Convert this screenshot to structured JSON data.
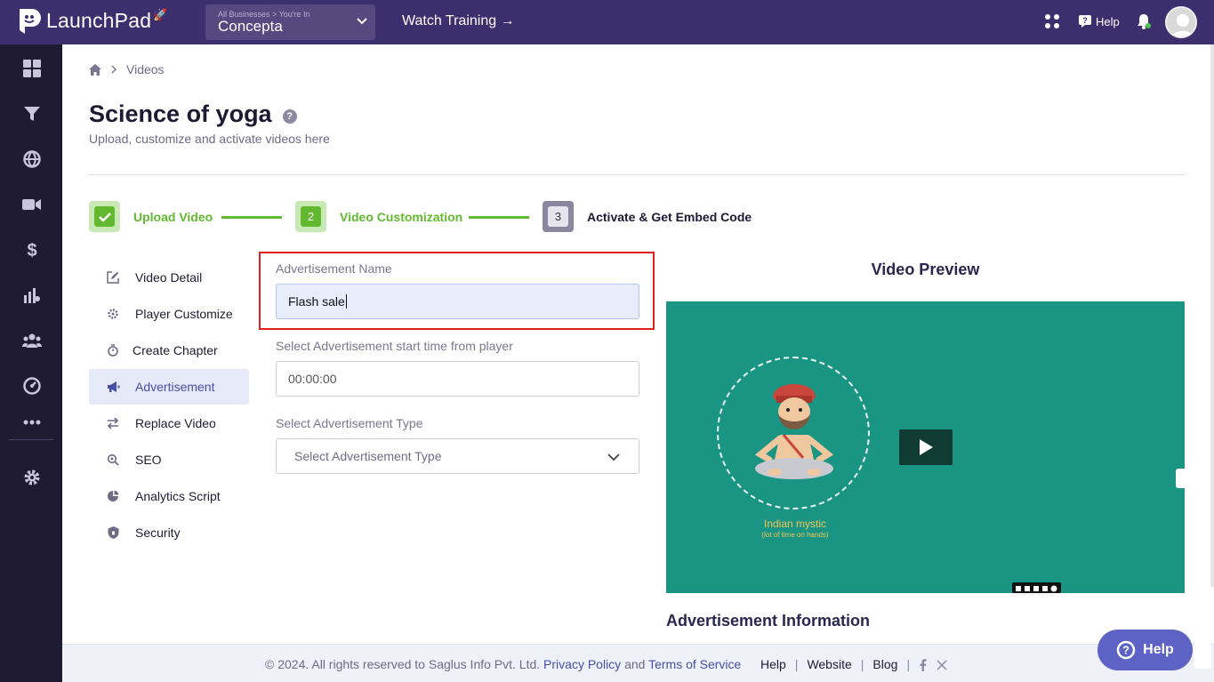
{
  "topbar": {
    "logo_text": "LaunchPad",
    "business_small": "All Businesses  >  You're In",
    "business_name": "Concepta",
    "watch_training": "Watch Training →",
    "help": "Help"
  },
  "breadcrumb": {
    "current": "Videos"
  },
  "page": {
    "title": "Science of yoga",
    "subtitle": "Upload, customize and activate videos here"
  },
  "steps": [
    {
      "label": "Upload Video",
      "number": ""
    },
    {
      "label": "Video Customization",
      "number": "2"
    },
    {
      "label": "Activate & Get Embed Code",
      "number": "3"
    }
  ],
  "menu": [
    {
      "label": "Video Detail",
      "icon": "edit-icon"
    },
    {
      "label": "Player Customize",
      "icon": "gear-brush-icon"
    },
    {
      "label": "Create Chapter",
      "icon": "timer-icon"
    },
    {
      "label": "Advertisement",
      "icon": "megaphone-icon"
    },
    {
      "label": "Replace Video",
      "icon": "swap-icon"
    },
    {
      "label": "SEO",
      "icon": "search-icon"
    },
    {
      "label": "Analytics Script",
      "icon": "pie-icon"
    },
    {
      "label": "Security",
      "icon": "shield-icon"
    }
  ],
  "form": {
    "ad_name_label": "Advertisement Name",
    "ad_name_value": "Flash sale",
    "start_time_label": "Select Advertisement start time from player",
    "start_time_value": "00:00:00",
    "ad_type_label": "Select Advertisement Type",
    "ad_type_value": "Select Advertisement Type"
  },
  "preview": {
    "title": "Video Preview",
    "mystic_title": "Indian mystic",
    "mystic_sub": "(lot of time on hands)",
    "ad_info": "Advertisement Information"
  },
  "footer": {
    "copyright": "©  2024. All rights reserved to Saglus Info Pvt. Ltd.",
    "privacy": "Privacy Policy",
    "and": "and",
    "terms": "Terms of Service",
    "help": "Help",
    "website": "Website",
    "blog": "Blog"
  },
  "help_button": "Help",
  "colors": {
    "topbar": "#3c2f6e",
    "sidebar": "#1f1b33",
    "accent_green": "#62b82f",
    "active_menu": "#e6e9f7",
    "video_bg": "#1a9583",
    "highlight_red": "#e0201f"
  }
}
